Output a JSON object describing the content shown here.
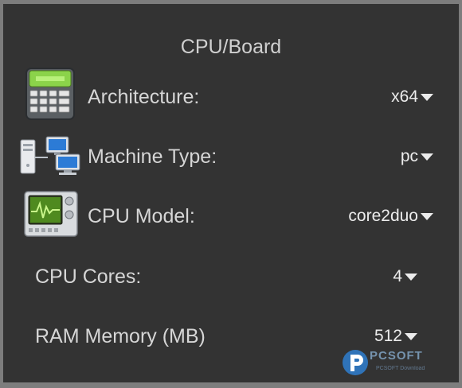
{
  "section": {
    "title": "CPU/Board"
  },
  "rows": [
    {
      "label": "Architecture:",
      "value": "x64",
      "icon": "calculator-icon"
    },
    {
      "label": "Machine Type:",
      "value": "pc",
      "icon": "network-computers-icon"
    },
    {
      "label": "CPU Model:",
      "value": "core2duo",
      "icon": "cpu-monitor-icon"
    },
    {
      "label": "CPU Cores:",
      "value": "4"
    },
    {
      "label": "RAM Memory (MB)",
      "value": "512"
    }
  ],
  "watermark": {
    "text": "PCSOFT",
    "sub": "PCSOFT Download",
    "icon": "p-logo-icon"
  },
  "colors": {
    "background": "#333333",
    "text": "#d6d6d6",
    "frame": "#7d7d7d"
  }
}
